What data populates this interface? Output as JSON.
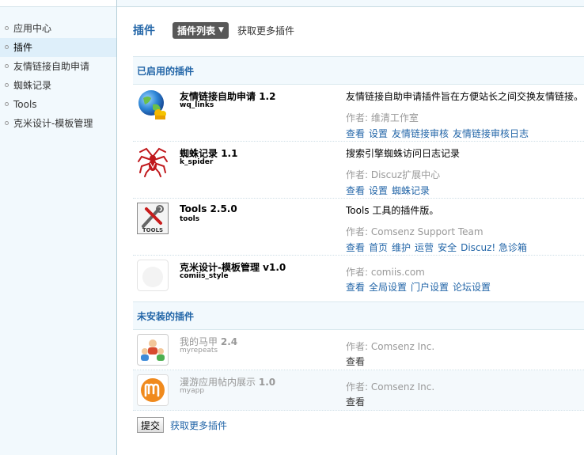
{
  "sidebar": {
    "items": [
      {
        "label": "应用中心"
      },
      {
        "label": "插件"
      },
      {
        "label": "友情链接自助申请"
      },
      {
        "label": "蜘蛛记录"
      },
      {
        "label": "Tools"
      },
      {
        "label": "克米设计-模板管理"
      }
    ]
  },
  "header": {
    "title": "插件",
    "tab_label": "插件列表",
    "more_link": "获取更多插件"
  },
  "enabled_section": {
    "title": "已启用的插件",
    "plugins": [
      {
        "name": "友情链接自助申请",
        "version": "1.2",
        "identifier": "wq_links",
        "description": "友情链接自助申请插件旨在方便站长之间交换友情链接。",
        "author": "作者: 维清工作室",
        "ops": [
          "查看",
          "设置",
          "友情链接审核",
          "友情链接审核日志"
        ],
        "icon": "globe-icon"
      },
      {
        "name": "蜘蛛记录",
        "version": "1.1",
        "identifier": "k_spider",
        "description": "搜索引擎蜘蛛访问日志记录",
        "author": "作者: Discuz扩展中心",
        "ops": [
          "查看",
          "设置",
          "蜘蛛记录"
        ],
        "icon": "spider-icon"
      },
      {
        "name": "Tools",
        "version": "2.5.0",
        "identifier": "tools",
        "description": "Tools 工具的插件版。",
        "author": "作者: Comsenz Support Team",
        "ops": [
          "查看",
          "首页",
          "维护",
          "运营",
          "安全",
          "Discuz! 急诊箱"
        ],
        "icon": "tools-icon",
        "icon_label": "TOOLS"
      },
      {
        "name": "克米设计-模板管理",
        "version": "v1.0",
        "identifier": "comiis_style",
        "description": "",
        "author": "作者: comiis.com",
        "ops": [
          "查看",
          "全局设置",
          "门户设置",
          "论坛设置"
        ],
        "icon": "blank-plugin-icon"
      }
    ]
  },
  "uninstalled_section": {
    "title": "未安装的插件",
    "plugins": [
      {
        "name": "我的马甲",
        "version": "2.4",
        "identifier": "myrepeats",
        "author": "作者: Comsenz Inc.",
        "ops": [
          "查看"
        ],
        "icon": "users-icon"
      },
      {
        "name": "漫游应用帖内展示",
        "version": "1.0",
        "identifier": "myapp",
        "author": "作者: Comsenz Inc.",
        "ops": [
          "查看"
        ],
        "icon": "myapp-icon"
      }
    ]
  },
  "footer": {
    "submit_label": "提交",
    "more_link": "获取更多插件"
  }
}
